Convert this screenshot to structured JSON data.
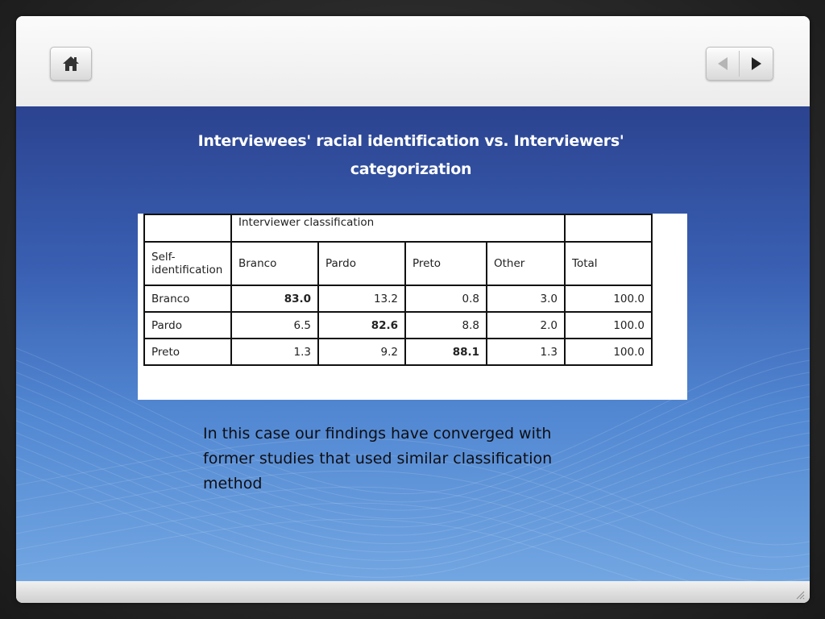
{
  "toolbar": {
    "home_icon": "home-icon",
    "prev_icon": "arrow-left-icon",
    "next_icon": "arrow-right-icon"
  },
  "slide": {
    "title_line1": "Interviewees' racial identification  vs. Interviewers'",
    "title_line2": "categorization",
    "table": {
      "header_top": "Interviewer classification",
      "row_header_label": "Self-identification",
      "columns": [
        "Branco",
        "Pardo",
        "Preto",
        "Other",
        "Total"
      ],
      "rows": [
        {
          "label": "Branco",
          "values": [
            "83.0",
            "13.2",
            "0.8",
            "3.0",
            "100.0"
          ]
        },
        {
          "label": "Pardo",
          "values": [
            "6.5",
            "82.6",
            "8.8",
            "2.0",
            "100.0"
          ]
        },
        {
          "label": "Preto",
          "values": [
            "1.3",
            "9.2",
            "88.1",
            "1.3",
            "100.0"
          ]
        }
      ]
    },
    "body_text_line1": "In this case our findings have converged with",
    "body_text_line2": "former studies that used similar classification",
    "body_text_line3": "method"
  },
  "colors": {
    "slide_top": "#2b4390",
    "slide_bottom": "#72a6e2",
    "title_text": "#ffffff"
  }
}
